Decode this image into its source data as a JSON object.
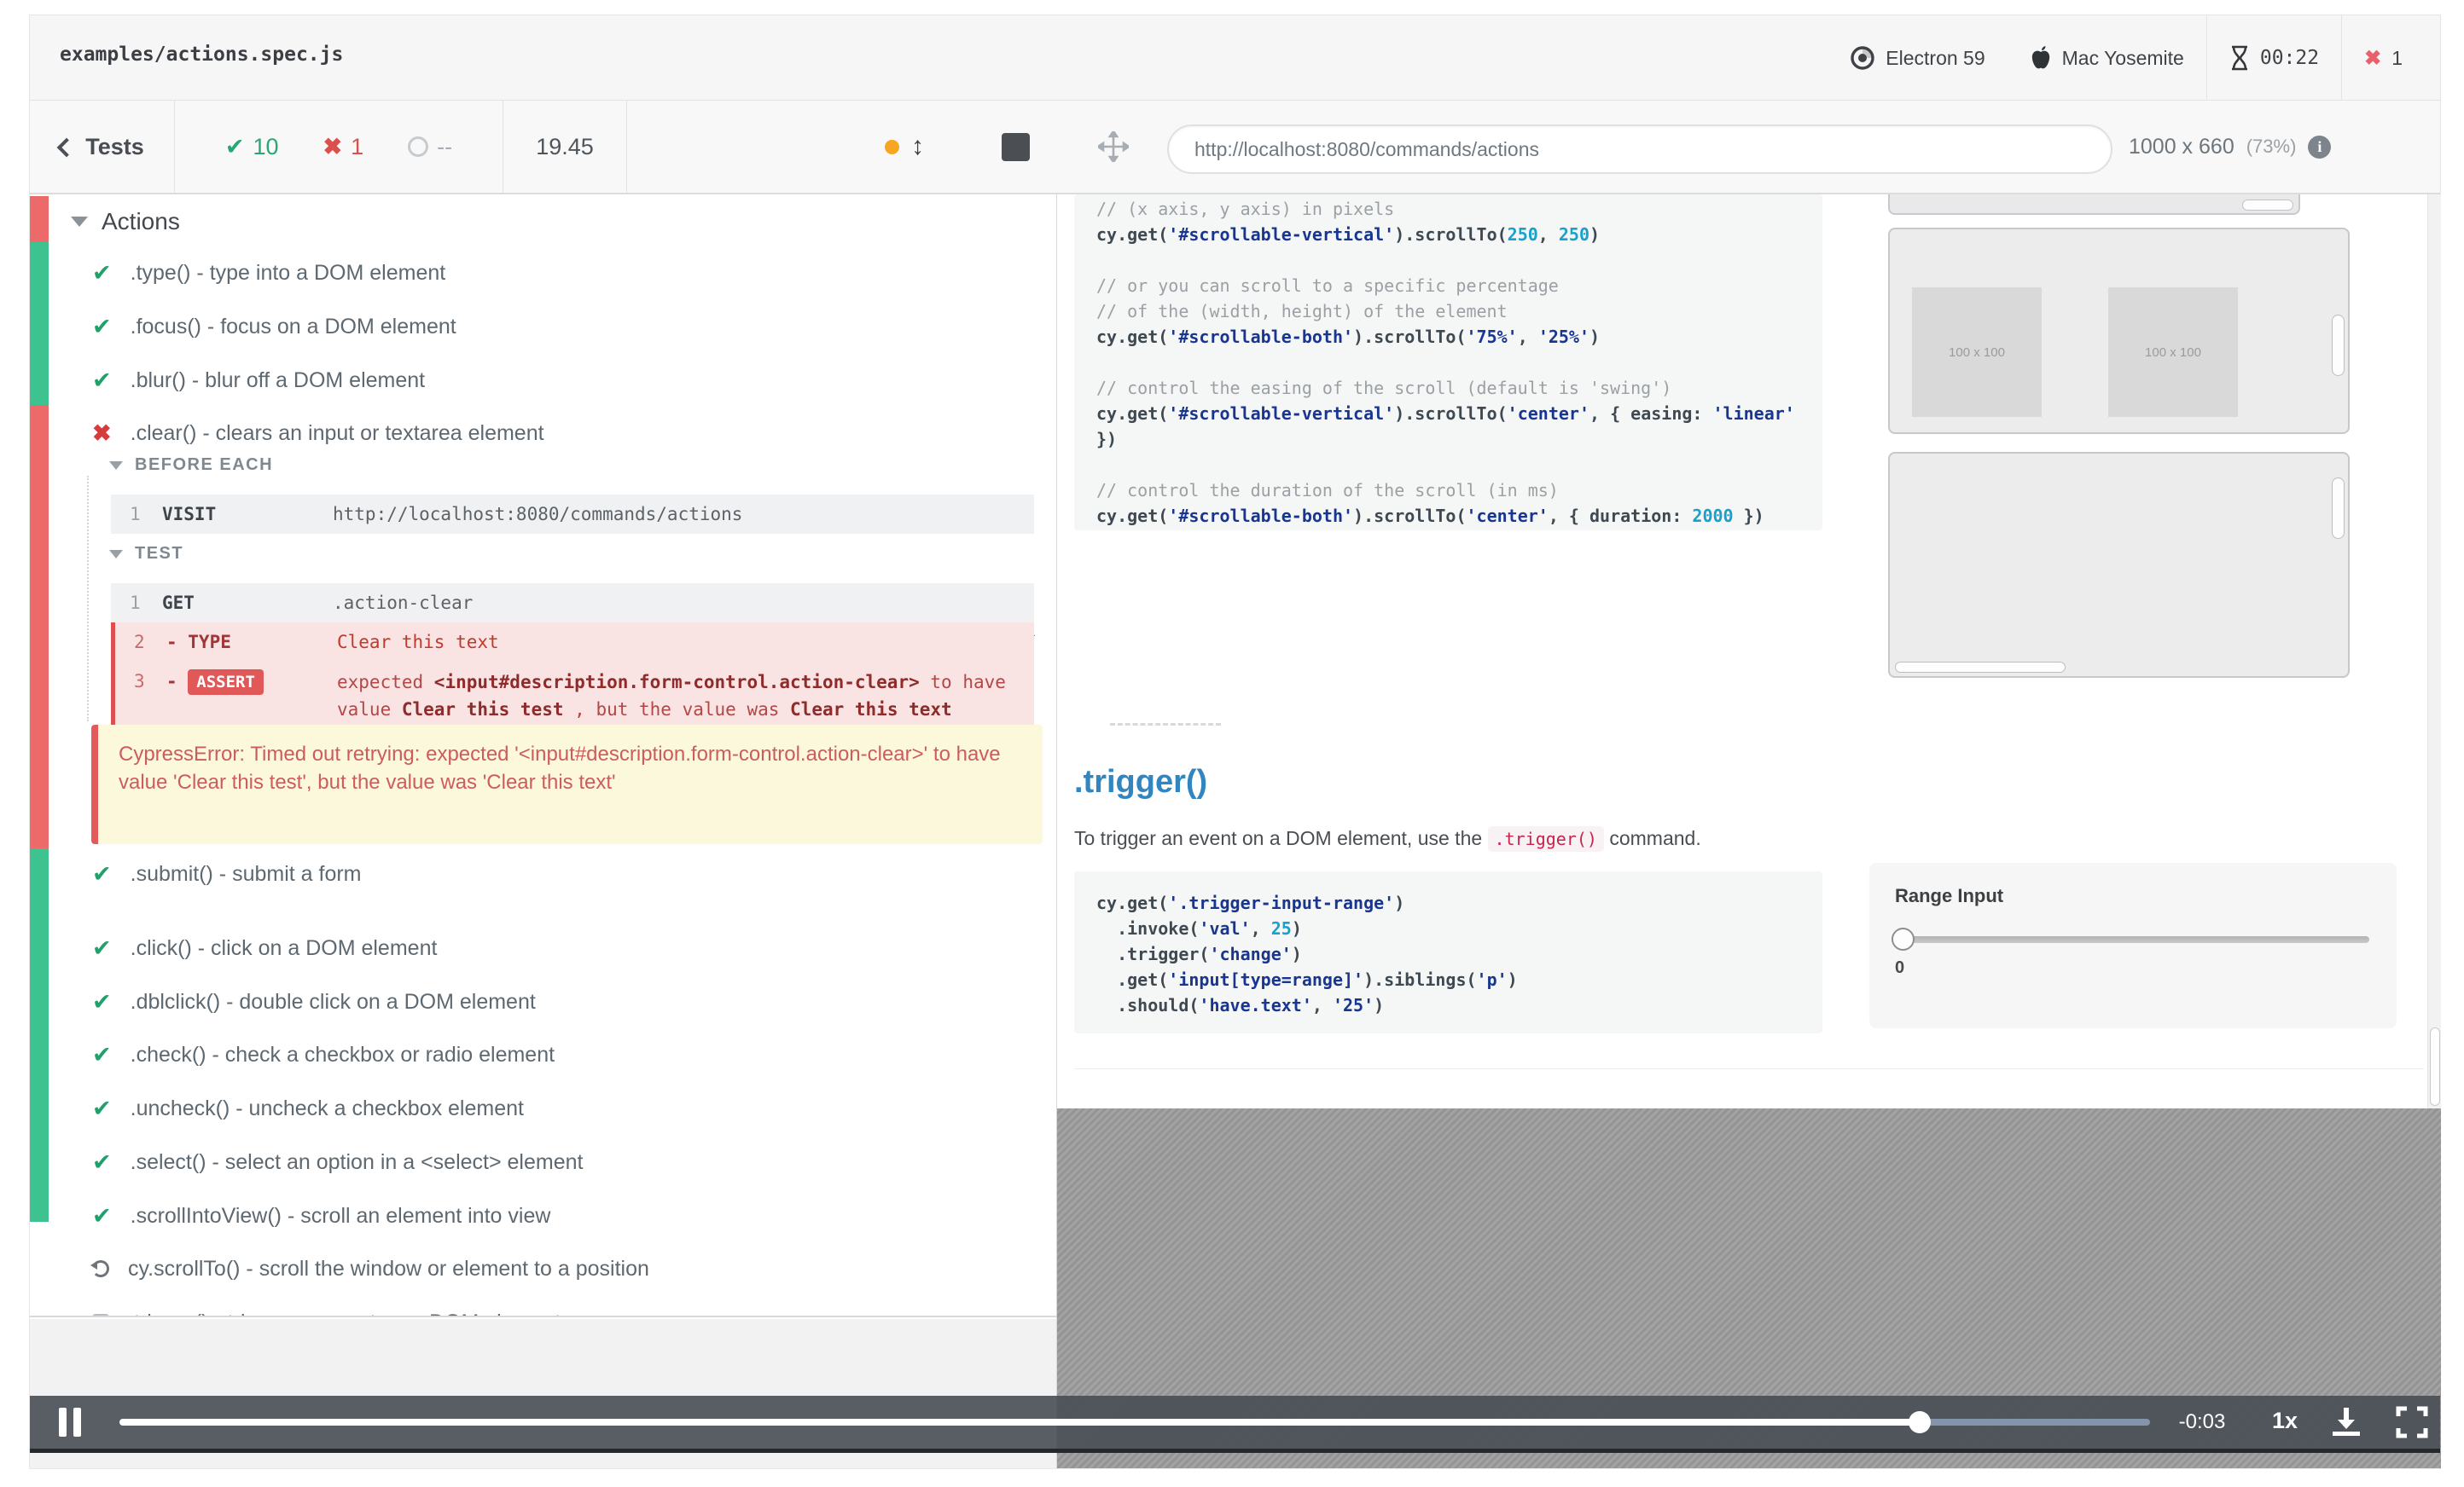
{
  "top_bar": {
    "spec_name": "examples/actions.spec.js",
    "browser": "Electron 59",
    "os": "Mac Yosemite",
    "timer": "00:22",
    "failure_count": "1"
  },
  "toolbar": {
    "back_label": "Tests",
    "passed_count": "10",
    "failed_count": "1",
    "pending_count": "--",
    "duration": "19.45"
  },
  "url_bar": {
    "url": "http://localhost:8080/commands/actions",
    "viewport_size": "1000 x 660",
    "viewport_scale": "(73%)"
  },
  "test_list": {
    "suite": "Actions",
    "items_before": [
      {
        "status": "passed",
        "label": ".type() - type into a DOM element"
      },
      {
        "status": "passed",
        "label": ".focus() - focus on a DOM element"
      },
      {
        "status": "passed",
        "label": ".blur() - blur off a DOM element"
      },
      {
        "status": "failed",
        "label": ".clear() - clears an input or textarea element"
      }
    ],
    "items_after": [
      {
        "status": "passed",
        "label": ".submit() - submit a form"
      },
      {
        "status": "passed",
        "label": ".click() - click on a DOM element"
      },
      {
        "status": "passed",
        "label": ".dblclick() - double click on a DOM element"
      },
      {
        "status": "passed",
        "label": ".check() - check a checkbox or radio element"
      },
      {
        "status": "passed",
        "label": ".uncheck() - uncheck a checkbox element"
      },
      {
        "status": "passed",
        "label": ".select() - select an option in a <select> element"
      },
      {
        "status": "passed",
        "label": ".scrollIntoView() - scroll an element into view"
      },
      {
        "status": "running",
        "label": "cy.scrollTo() - scroll the window or element to a position"
      },
      {
        "status": "pending",
        "label": ".trigger() - trigger an event on a DOM element"
      }
    ],
    "expansion": {
      "before_each_label": "BEFORE EACH",
      "test_label": "TEST",
      "before_each_commands": [
        {
          "n": "1",
          "name": "VISIT",
          "value": "http://localhost:8080/commands/actions",
          "state": "normal"
        }
      ],
      "test_commands": [
        {
          "n": "1",
          "name": "GET",
          "value": ".action-clear",
          "state": "normal"
        },
        {
          "n": "2",
          "name": "- TYPE",
          "value": "Clear this text",
          "state": "failed"
        },
        {
          "n": "3",
          "name": "- ",
          "badge": "ASSERT",
          "state": "failed",
          "message": [
            [
              "n",
              "expected "
            ],
            [
              "b",
              "<input#description.form-control.action-clear>"
            ],
            [
              "n",
              " to have value "
            ],
            [
              "b",
              "Clear this test"
            ],
            [
              "n",
              " , but the value was "
            ],
            [
              "b",
              "Clear this text"
            ]
          ]
        }
      ],
      "error": "CypressError: Timed out retrying: expected '<input#description.form-control.action-clear>' to have value 'Clear this test', but the value was 'Clear this text'"
    }
  },
  "app_preview": {
    "code_block_1": [
      [
        [
          "c",
          "// (x axis, y axis) in pixels"
        ]
      ],
      [
        [
          "p",
          "cy.get("
        ],
        [
          "s",
          "'#scrollable-vertical'"
        ],
        [
          "p",
          ").scrollTo("
        ],
        [
          "n",
          "250"
        ],
        [
          "p",
          ", "
        ],
        [
          "n",
          "250"
        ],
        [
          "p",
          ")"
        ]
      ],
      [],
      [
        [
          "c",
          "// or you can scroll to a specific percentage"
        ]
      ],
      [
        [
          "c",
          "// of the (width, height) of the element"
        ]
      ],
      [
        [
          "p",
          "cy.get("
        ],
        [
          "s",
          "'#scrollable-both'"
        ],
        [
          "p",
          ").scrollTo("
        ],
        [
          "s",
          "'75%'"
        ],
        [
          "p",
          ", "
        ],
        [
          "s",
          "'25%'"
        ],
        [
          "p",
          ")"
        ]
      ],
      [],
      [
        [
          "c",
          "// control the easing of the scroll (default is 'swing')"
        ]
      ],
      [
        [
          "p",
          "cy.get("
        ],
        [
          "s",
          "'#scrollable-vertical'"
        ],
        [
          "p",
          ").scrollTo("
        ],
        [
          "s",
          "'center'"
        ],
        [
          "p",
          ", { easing: "
        ],
        [
          "s",
          "'linear'"
        ]
      ],
      [
        [
          "p",
          "})"
        ]
      ],
      [],
      [
        [
          "c",
          "// control the duration of the scroll (in ms)"
        ]
      ],
      [
        [
          "p",
          "cy.get("
        ],
        [
          "s",
          "'#scrollable-both'"
        ],
        [
          "p",
          ").scrollTo("
        ],
        [
          "s",
          "'center'"
        ],
        [
          "p",
          ", { duration: "
        ],
        [
          "n",
          "2000"
        ],
        [
          "p",
          " })"
        ]
      ]
    ],
    "trigger_heading": ".trigger()",
    "trigger_desc_before": "To trigger an event on a DOM element, use the ",
    "trigger_desc_code": ".trigger()",
    "trigger_desc_after": " command.",
    "code_block_2": [
      [
        [
          "p",
          "cy.get("
        ],
        [
          "s",
          "'.trigger-input-range'"
        ],
        [
          "p",
          ")"
        ]
      ],
      [
        [
          "p",
          "  .invoke("
        ],
        [
          "s",
          "'val'"
        ],
        [
          "p",
          ", "
        ],
        [
          "n",
          "25"
        ],
        [
          "p",
          ")"
        ]
      ],
      [
        [
          "p",
          "  .trigger("
        ],
        [
          "s",
          "'change'"
        ],
        [
          "p",
          ")"
        ]
      ],
      [
        [
          "p",
          "  .get("
        ],
        [
          "s",
          "'input[type=range]'"
        ],
        [
          "p",
          ").siblings("
        ],
        [
          "s",
          "'p'"
        ],
        [
          "p",
          ")"
        ]
      ],
      [
        [
          "p",
          "  .should("
        ],
        [
          "s",
          "'have.text'"
        ],
        [
          "p",
          ", "
        ],
        [
          "s",
          "'25'"
        ],
        [
          "p",
          ")"
        ]
      ]
    ],
    "placeholder_text": "100 x 100",
    "range_input": {
      "label": "Range Input",
      "value": "0"
    }
  },
  "player": {
    "time_remaining": "-0:03",
    "speed": "1x"
  },
  "colors": {
    "pass_green": "#26a873",
    "fail_red": "#d9504c",
    "strip_green": "#3ec28f",
    "strip_red": "#ec6a6a",
    "error_bg": "#fcf8dc",
    "accent_blue": "#3286c0"
  }
}
